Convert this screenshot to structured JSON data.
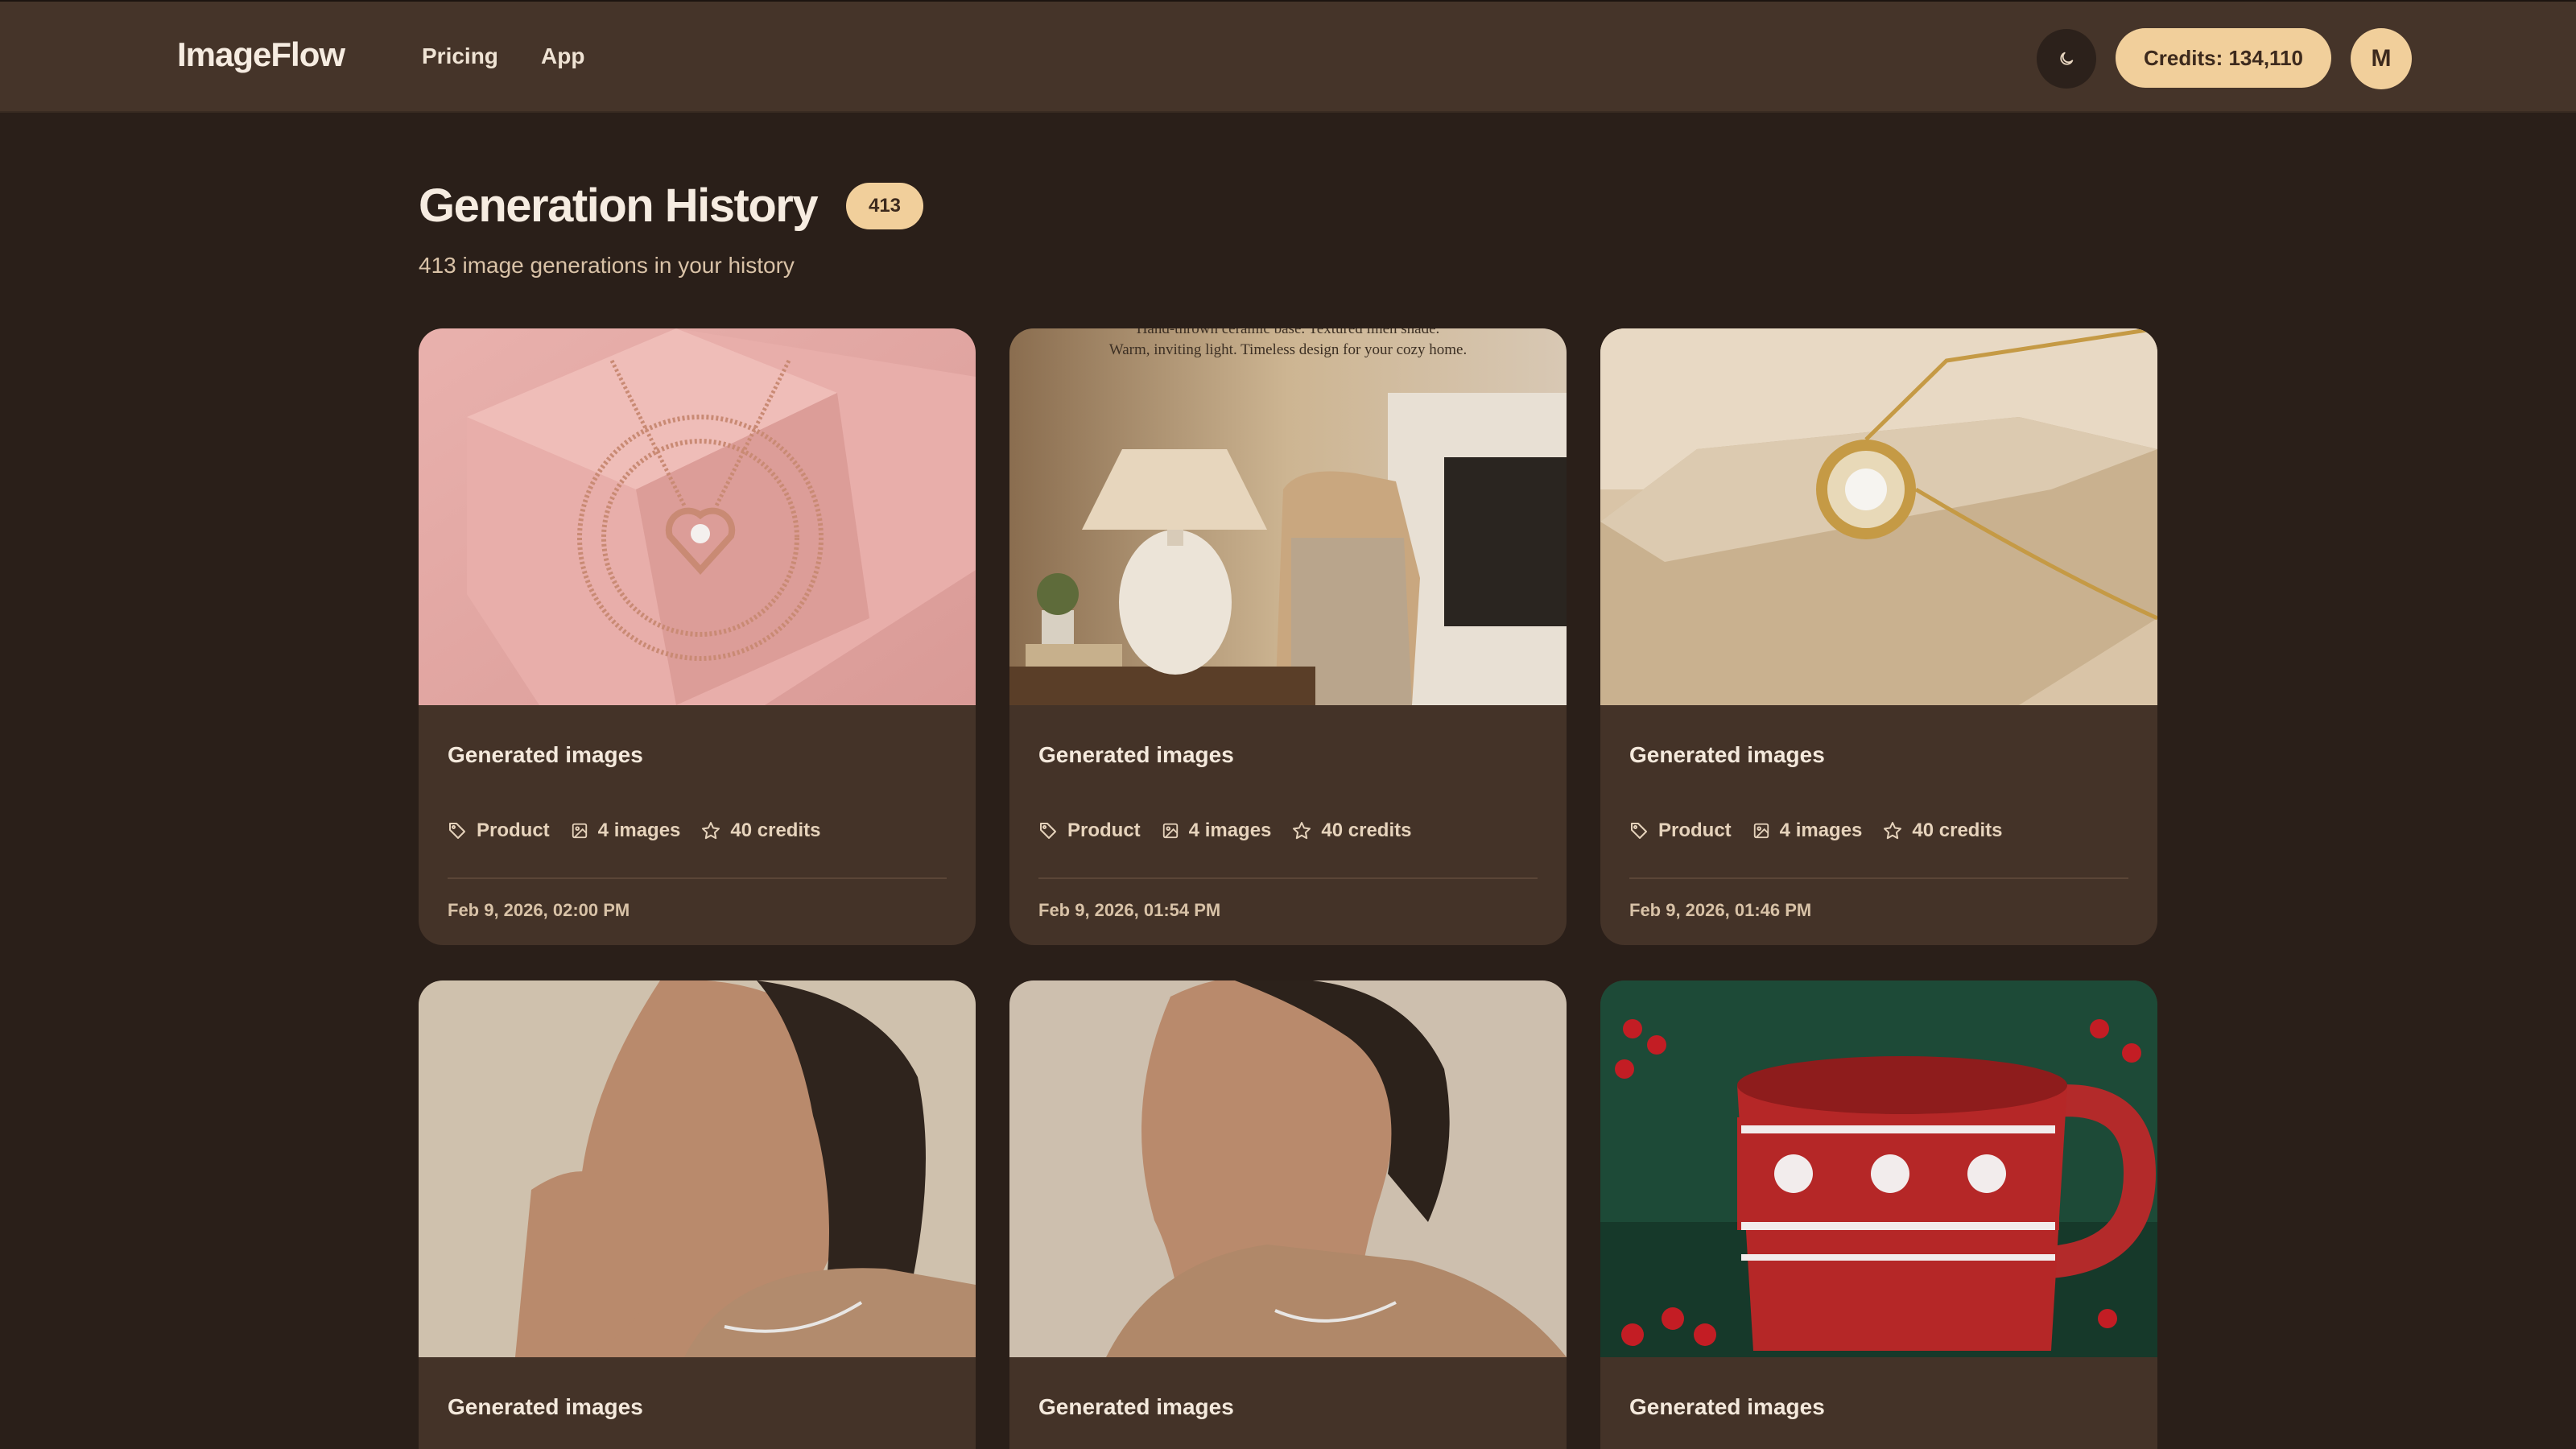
{
  "header": {
    "logo": "ImageFlow",
    "nav": {
      "pricing": "Pricing",
      "app": "App"
    },
    "theme_icon": "moon-icon",
    "credits": "Credits: 134,110",
    "avatar_initial": "M"
  },
  "page": {
    "title": "Generation History",
    "count_badge": "413",
    "subtitle": "413 image generations in your history"
  },
  "cards": [
    {
      "title": "Generated images",
      "category": "Product",
      "images": "4 images",
      "credits": "40 credits",
      "date": "Feb 9, 2026, 02:00 PM",
      "thumbnail": "rose-gold-heart-necklace-on-pink-box"
    },
    {
      "title": "Generated images",
      "category": "Product",
      "images": "4 images",
      "credits": "40 credits",
      "date": "Feb 9, 2026, 01:54 PM",
      "thumbnail": "ceramic-table-lamp-living-room",
      "thumbnail_text": [
        "Hand-thrown ceramic base. Textured linen shade.",
        "Warm, inviting light. Timeless design for your cozy home."
      ]
    },
    {
      "title": "Generated images",
      "category": "Product",
      "images": "4 images",
      "credits": "40 credits",
      "date": "Feb 9, 2026, 01:46 PM",
      "thumbnail": "gold-pendant-on-stone-block"
    },
    {
      "title": "Generated images",
      "thumbnail": "woman-wearing-silver-necklace-profile"
    },
    {
      "title": "Generated images",
      "thumbnail": "woman-wearing-silver-necklace-portrait"
    },
    {
      "title": "Generated images",
      "thumbnail": "red-nordic-christmas-mug-with-berries"
    }
  ],
  "colors": {
    "background": "#2a1f19",
    "header": "#453429",
    "card": "#443328",
    "accent": "#f1cf9b"
  },
  "icons": {
    "category": "tag-icon",
    "images": "image-icon",
    "credits": "star-icon"
  }
}
